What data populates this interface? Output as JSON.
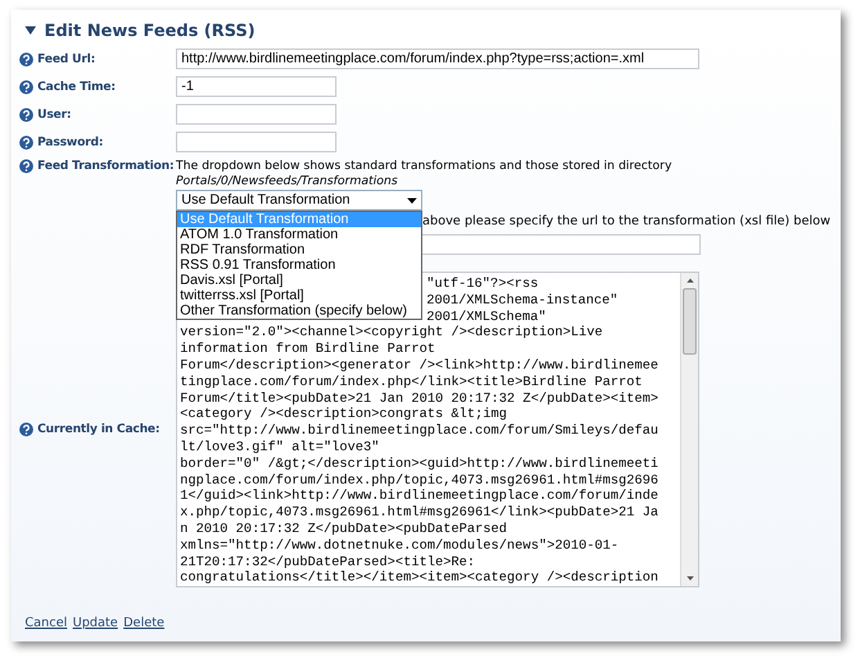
{
  "section": {
    "title": "Edit News Feeds (RSS)",
    "expanded": true
  },
  "fields": [
    {
      "label": "Feed Url:",
      "value": "http://www.birdlinemeetingplace.com/forum/index.php?type=rss;action=.xml"
    },
    {
      "label": "Cache Time:",
      "value": "-1"
    },
    {
      "label": "User:"
    },
    {
      "label": "Password:"
    }
  ],
  "transformation": {
    "label": "Feed Transformation:",
    "description": "The dropdown below shows standard transformations and those stored in directory",
    "directory": "Portals/0/Newsfeeds/Transformations",
    "dropdown": {
      "value": "Use Default Transformation",
      "expanded": true,
      "options": [
        {
          "label": "Use Default Transformation",
          "selected": true
        },
        {
          "label": "ATOM 1.0 Transformation",
          "selected": false
        },
        {
          "label": "RDF Transformation",
          "selected": false
        },
        {
          "label": "RSS 0.91 Transformation",
          "selected": false
        },
        {
          "label": "Davis.xsl [Portal]",
          "selected": false
        },
        {
          "label": "twitterrss.xsl [Portal]",
          "selected": false
        },
        {
          "label": "Other Transformation (specify below)",
          "selected": false
        }
      ]
    },
    "hint": "above please specify the url to the transformation (xsl file) below"
  },
  "cache": {
    "label": "Currently in Cache:",
    "line_tails": [
      "\"utf-16\"?><rss",
      "2001/XMLSchema-instance\"",
      "2001/XMLSchema\""
    ],
    "lines": [
      "version=\"2.0\"><channel><copyright /><description>Live",
      "information from Birdline Parrot",
      "Forum</description><generator /><link>http://www.birdlinemee",
      "tingplace.com/forum/index.php</link><title>Birdline Parrot",
      "Forum</title><pubDate>21 Jan 2010 20:17:32 Z</pubDate><item>",
      "<category /><description>congrats &lt;img",
      "src=\"http://www.birdlinemeetingplace.com/forum/Smileys/defau",
      "lt/love3.gif\" alt=\"love3\"",
      "border=\"0\" /&gt;</description><guid>http://www.birdlinemeeti",
      "ngplace.com/forum/index.php/topic,4073.msg26961.html#msg2696",
      "1</guid><link>http://www.birdlinemeetingplace.com/forum/inde",
      "x.php/topic,4073.msg26961.html#msg26961</link><pubDate>21 Ja",
      "n 2010 20:17:32 Z</pubDate><pubDateParsed",
      "xmlns=\"http://www.dotnetnuke.com/modules/news\">2010-01-",
      "21T20:17:32</pubDateParsed><title>Re:",
      "congratulations</title></item><item><category /><description"
    ]
  },
  "links": [
    "Cancel",
    "Update",
    "Delete"
  ]
}
